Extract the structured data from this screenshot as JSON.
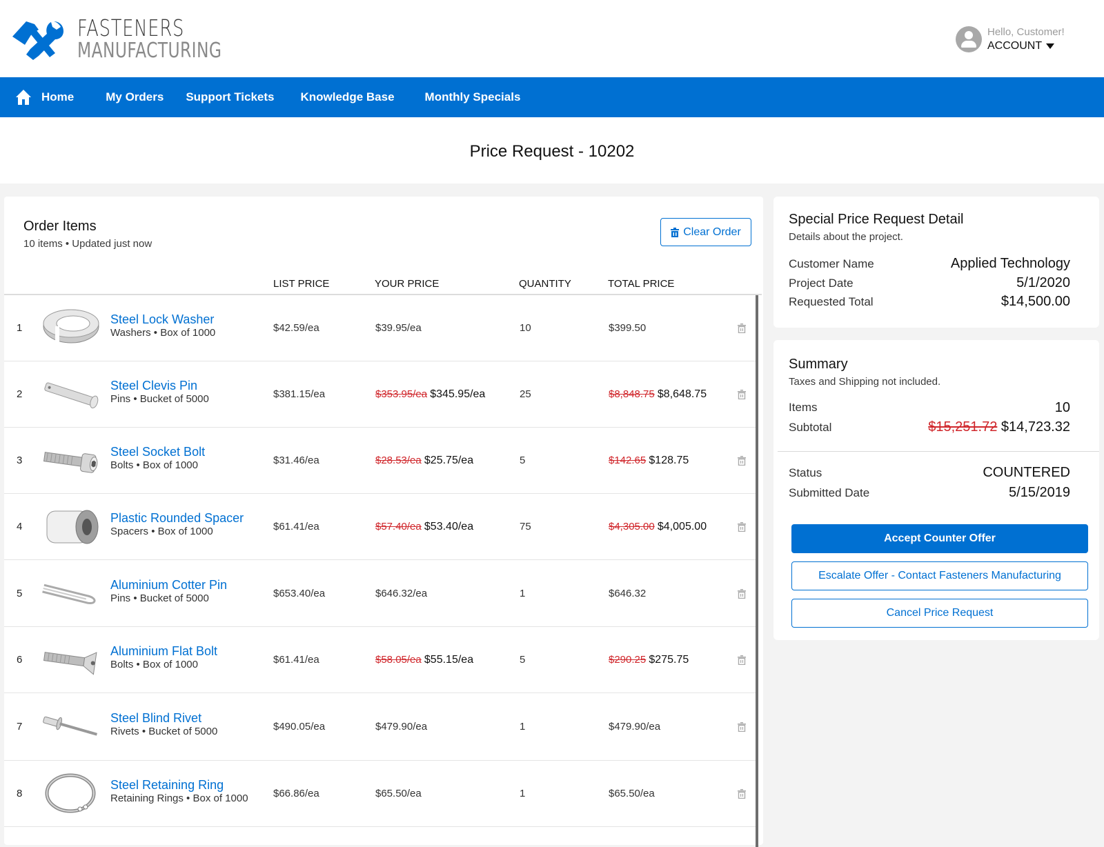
{
  "brand": {
    "line1": "FASTENERS",
    "line2": "MANUFACTURING",
    "accent_color": "#0070d2"
  },
  "account": {
    "greeting": "Hello, Customer!",
    "label": "ACCOUNT"
  },
  "nav": {
    "items": [
      {
        "label": "Home",
        "icon": "home-icon"
      },
      {
        "label": "My Orders"
      },
      {
        "label": "Support Tickets"
      },
      {
        "label": "Knowledge Base"
      },
      {
        "label": "Monthly Specials"
      }
    ]
  },
  "page": {
    "title": "Price Request - 10202"
  },
  "order_items": {
    "title": "Order Items",
    "subtitle": "10 items • Updated just now",
    "clear_label": "Clear Order",
    "columns": [
      "LIST PRICE",
      "YOUR PRICE",
      "QUANTITY",
      "TOTAL PRICE"
    ],
    "rows": [
      {
        "num": "1",
        "name": "Steel Lock Washer",
        "meta": "Washers • Box of 1000",
        "image": "lock-washer",
        "list_price": "$42.59/ea",
        "your_price_old": "",
        "your_price": "$39.95/ea",
        "quantity": "10",
        "total_old": "",
        "total": "$399.50"
      },
      {
        "num": "2",
        "name": "Steel Clevis Pin",
        "meta": "Pins • Bucket of 5000",
        "image": "clevis-pin",
        "list_price": "$381.15/ea",
        "your_price_old": "$353.95/ea",
        "your_price": "$345.95/ea",
        "quantity": "25",
        "total_old": "$8,848.75",
        "total": "$8,648.75"
      },
      {
        "num": "3",
        "name": "Steel Socket Bolt",
        "meta": "Bolts • Box of 1000",
        "image": "socket-bolt",
        "list_price": "$31.46/ea",
        "your_price_old": "$28.53/ea",
        "your_price": "$25.75/ea",
        "quantity": "5",
        "total_old": "$142.65",
        "total": "$128.75"
      },
      {
        "num": "4",
        "name": "Plastic Rounded Spacer",
        "meta": "Spacers • Box of 1000",
        "image": "spacer",
        "list_price": "$61.41/ea",
        "your_price_old": "$57.40/ea",
        "your_price": "$53.40/ea",
        "quantity": "75",
        "total_old": "$4,305.00",
        "total": "$4,005.00"
      },
      {
        "num": "5",
        "name": "Aluminium Cotter Pin",
        "meta": "Pins • Bucket of 5000",
        "image": "cotter-pin",
        "list_price": "$653.40/ea",
        "your_price_old": "",
        "your_price": "$646.32/ea",
        "quantity": "1",
        "total_old": "",
        "total": "$646.32"
      },
      {
        "num": "6",
        "name": "Aluminium Flat Bolt",
        "meta": "Bolts • Box of 1000",
        "image": "flat-bolt",
        "list_price": "$61.41/ea",
        "your_price_old": "$58.05/ea",
        "your_price": "$55.15/ea",
        "quantity": "5",
        "total_old": "$290.25",
        "total": "$275.75"
      },
      {
        "num": "7",
        "name": "Steel Blind Rivet",
        "meta": "Rivets • Bucket of 5000",
        "image": "blind-rivet",
        "list_price": "$490.05/ea",
        "your_price_old": "",
        "your_price": "$479.90/ea",
        "quantity": "1",
        "total_old": "",
        "total": "$479.90/ea"
      },
      {
        "num": "8",
        "name": "Steel Retaining Ring",
        "meta": "Retaining Rings • Box of 1000",
        "image": "retaining-ring",
        "list_price": "$66.86/ea",
        "your_price_old": "",
        "your_price": "$65.50/ea",
        "quantity": "1",
        "total_old": "",
        "total": "$65.50/ea"
      }
    ]
  },
  "detail": {
    "title": "Special Price Request Detail",
    "subtitle": "Details about the project.",
    "fields": [
      {
        "label": "Customer Name",
        "value": "Applied Technology"
      },
      {
        "label": "Project Date",
        "value": "5/1/2020"
      },
      {
        "label": "Requested Total",
        "value": "$14,500.00"
      }
    ]
  },
  "summary": {
    "title": "Summary",
    "subtitle": "Taxes and Shipping not included.",
    "items_label": "Items",
    "items_value": "10",
    "subtotal_label": "Subtotal",
    "subtotal_old": "$15,251.72",
    "subtotal": "$14,723.32",
    "status_label": "Status",
    "status_value": "COUNTERED",
    "submitted_label": "Submitted Date",
    "submitted_value": "5/15/2019",
    "accept_label": "Accept Counter Offer",
    "escalate_label": "Escalate Offer - Contact Fasteners Manufacturing",
    "cancel_label": "Cancel Price Request"
  }
}
